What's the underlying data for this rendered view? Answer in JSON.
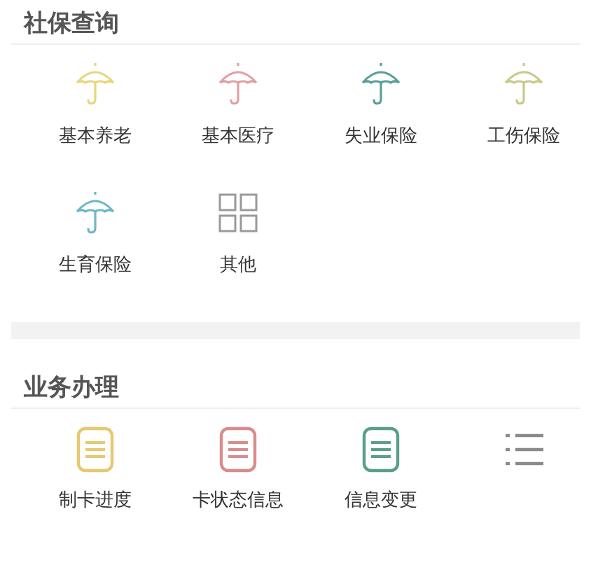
{
  "sections": [
    {
      "title": "社保查询",
      "items": [
        {
          "kind": "umbrella",
          "color": "#e8d67a",
          "label": "基本养老"
        },
        {
          "kind": "umbrella",
          "color": "#e0a0a4",
          "label": "基本医疗"
        },
        {
          "kind": "umbrella",
          "color": "#5a9e98",
          "label": "失业保险"
        },
        {
          "kind": "umbrella",
          "color": "#c8c98a",
          "label": "工伤保险"
        },
        {
          "kind": "umbrella",
          "color": "#6cb8c8",
          "label": "生育保险"
        },
        {
          "kind": "grid",
          "color": "#9a9a9a",
          "label": "其他"
        }
      ]
    },
    {
      "title": "业务办理",
      "items": [
        {
          "kind": "clipboard",
          "color": "#e8c870",
          "label": "制卡进度"
        },
        {
          "kind": "clipboard",
          "color": "#d98c8c",
          "label": "卡状态信息"
        },
        {
          "kind": "clipboard",
          "color": "#5a9e8c",
          "label": "信息变更"
        },
        {
          "kind": "list",
          "color": "#8a8a8a"
        }
      ]
    }
  ]
}
